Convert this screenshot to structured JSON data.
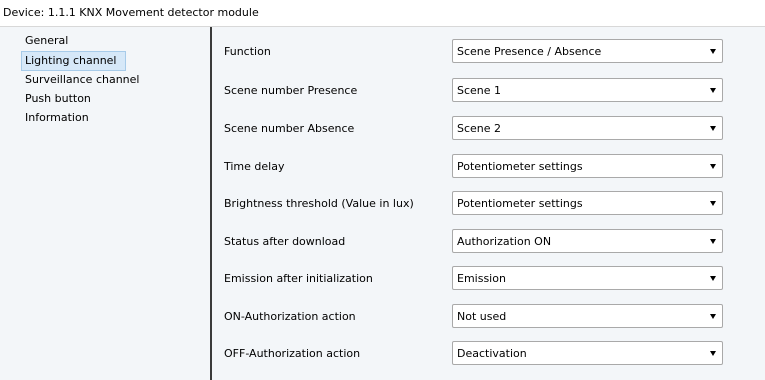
{
  "window": {
    "title": "Device: 1.1.1  KNX Movement detector module"
  },
  "sidebar": {
    "items": [
      {
        "label": "General"
      },
      {
        "label": "Lighting channel"
      },
      {
        "label": "Surveillance channel"
      },
      {
        "label": "Push button"
      },
      {
        "label": "Information"
      }
    ],
    "selected": "Lighting channel"
  },
  "params": [
    {
      "label": "Function",
      "value": "Scene Presence / Absence"
    },
    {
      "label": "Scene number Presence",
      "value": "Scene 1"
    },
    {
      "label": "Scene number Absence",
      "value": "Scene 2"
    },
    {
      "label": "Time delay",
      "value": "Potentiometer settings"
    },
    {
      "label": "Brightness threshold (Value in lux)",
      "value": "Potentiometer settings"
    },
    {
      "label": "Status after download",
      "value": "Authorization ON"
    },
    {
      "label": "Emission after initialization",
      "value": "Emission"
    },
    {
      "label": "ON-Authorization action",
      "value": "Not used"
    },
    {
      "label": "OFF-Authorization action",
      "value": "Deactivation"
    }
  ],
  "icons": {
    "dropdown": "chevron-down-icon"
  },
  "colors": {
    "panel_bg": "#f3f6f9",
    "selected_bg": "#d6e8f8",
    "divider": "#3a3a3a"
  }
}
